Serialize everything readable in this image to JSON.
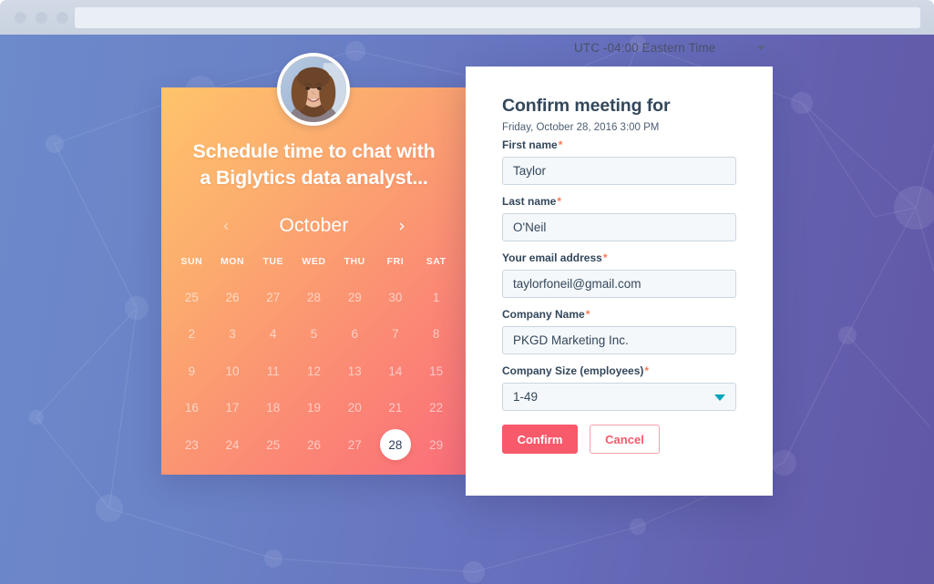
{
  "browser": {
    "traffic_lights": [
      "close-dot",
      "minimize-dot",
      "maximize-dot"
    ],
    "address_bar_value": "",
    "address_bar_placeholder": ""
  },
  "timezone": {
    "label": "UTC -04:00 Eastern Time",
    "caret_icon": "chevron-down-icon"
  },
  "calendar_card": {
    "avatar_icon": "avatar-photo",
    "headline_line1": "Schedule time to chat with",
    "headline_line2": "a Biglytics data analyst...",
    "prev_icon": "‹",
    "next_icon": "›",
    "month": "October",
    "weekdays": [
      "SUN",
      "MON",
      "TUE",
      "WED",
      "THU",
      "FRI",
      "SAT"
    ],
    "weeks": [
      [
        "25",
        "26",
        "27",
        "28",
        "29",
        "30",
        "1"
      ],
      [
        "2",
        "3",
        "4",
        "5",
        "6",
        "7",
        "8"
      ],
      [
        "9",
        "10",
        "11",
        "12",
        "13",
        "14",
        "15"
      ],
      [
        "16",
        "17",
        "18",
        "19",
        "20",
        "21",
        "22"
      ],
      [
        "23",
        "24",
        "25",
        "26",
        "27",
        "28",
        "29"
      ]
    ],
    "selected_day": "28",
    "selected_week_index": 4,
    "selected_day_index": 5
  },
  "form": {
    "title": "Confirm meeting for",
    "subtitle": "Friday, October 28, 2016 3:00 PM",
    "required_marker": "*",
    "fields": [
      {
        "label": "First name",
        "value": "Taylor",
        "placeholder": "First name",
        "required": true,
        "type": "text"
      },
      {
        "label": "Last name",
        "value": "O'Neil",
        "placeholder": "Last name",
        "required": true,
        "type": "text"
      },
      {
        "label": "Your email address",
        "value": "taylorfoneil@gmail.com",
        "placeholder": "Your email address",
        "required": true,
        "type": "email"
      },
      {
        "label": "Company Name",
        "value": "PKGD Marketing Inc.",
        "placeholder": "Company Name",
        "required": true,
        "type": "text"
      },
      {
        "label": "Company Size (employees)",
        "value": "1-49",
        "placeholder": "Company Size",
        "required": true,
        "type": "select",
        "caret_icon": "chevron-down-icon"
      }
    ],
    "confirm_label": "Confirm",
    "cancel_label": "Cancel"
  },
  "colors": {
    "accent_coral": "#f8596b",
    "required_orange": "#fc7a59",
    "select_caret_teal": "#00a4bd",
    "text_navy": "#33475b",
    "bg_blue": "#6d8acb",
    "bg_purple": "#6158a6",
    "card_orange_start": "#ffc46b",
    "card_orange_end": "#fb6e79"
  }
}
